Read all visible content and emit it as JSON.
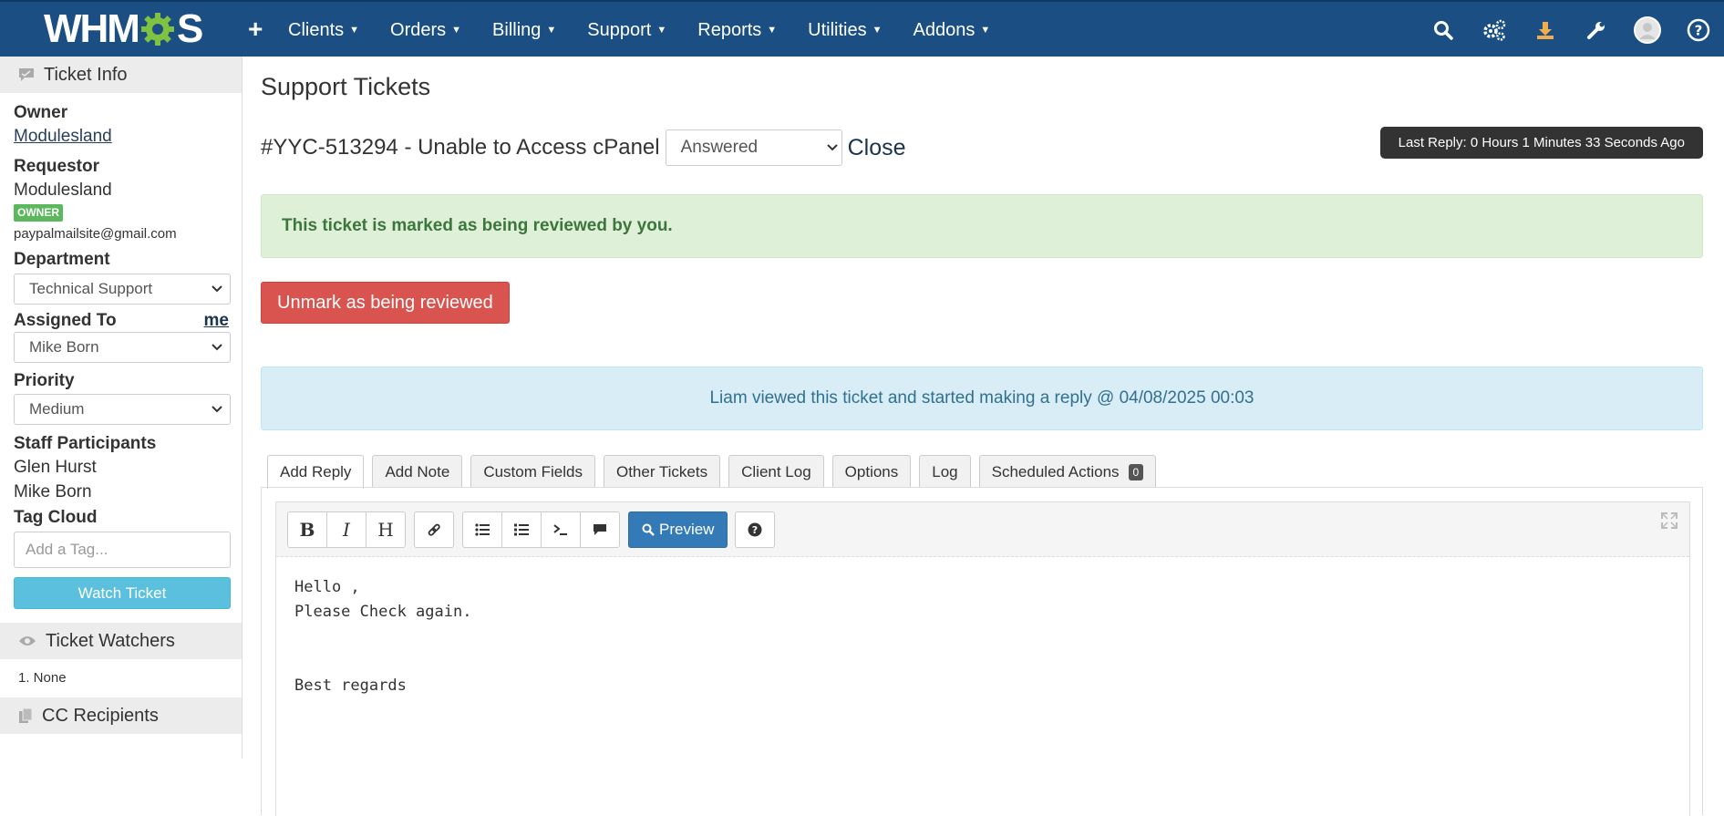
{
  "topbar": {
    "logo_left": "WHM",
    "logo_right": "S",
    "nav": [
      {
        "label": "Clients"
      },
      {
        "label": "Orders"
      },
      {
        "label": "Billing"
      },
      {
        "label": "Support"
      },
      {
        "label": "Reports"
      },
      {
        "label": "Utilities"
      },
      {
        "label": "Addons"
      }
    ],
    "icons": [
      "plus-icon",
      "search-icon",
      "cogs-icon",
      "download-icon",
      "wrench-icon",
      "avatar",
      "help-icon"
    ]
  },
  "sidebar": {
    "ticket_info_title": "Ticket Info",
    "owner_label": "Owner",
    "owner_value": "Modulesland",
    "requestor_label": "Requestor",
    "requestor_value": "Modulesland",
    "owner_badge": "OWNER",
    "email": "paypalmailsite@gmail.com",
    "department_label": "Department",
    "department_value": "Technical Support",
    "assigned_label": "Assigned To",
    "assigned_me": "me",
    "assigned_value": "Mike Born",
    "priority_label": "Priority",
    "priority_value": "Medium",
    "staff_label": "Staff Participants",
    "staff": [
      "Glen Hurst",
      "Mike Born"
    ],
    "tag_label": "Tag Cloud",
    "tag_placeholder": "Add a Tag...",
    "watch_button": "Watch Ticket",
    "watchers_title": "Ticket Watchers",
    "watchers_item": "1. None",
    "cc_title": "CC Recipients"
  },
  "main": {
    "page_title": "Support Tickets",
    "ticket_title": "#YYC-513294 - Unable to Access cPanel",
    "status_value": "Answered",
    "close_link": "Close",
    "last_reply": "Last Reply: 0 Hours 1 Minutes 33 Seconds Ago",
    "review_alert": "This ticket is marked as being reviewed by you.",
    "unmark_button": "Unmark as being reviewed",
    "info_alert": "Liam viewed this ticket and started making a reply @ 04/08/2025 00:03",
    "tabs": [
      {
        "label": "Add Reply"
      },
      {
        "label": "Add Note"
      },
      {
        "label": "Custom Fields"
      },
      {
        "label": "Other Tickets"
      },
      {
        "label": "Client Log"
      },
      {
        "label": "Options"
      },
      {
        "label": "Log"
      },
      {
        "label": "Scheduled Actions",
        "badge": "0"
      }
    ],
    "toolbar": {
      "bold": "B",
      "italic": "I",
      "heading": "H",
      "preview": "Preview"
    },
    "reply_text": "Hello ,\nPlease Check again.\n\n\nBest regards"
  },
  "colors": {
    "topbar": "#1b4f84",
    "success_bg": "#dff0d8",
    "danger": "#d9534f",
    "info_bg": "#d9edf7",
    "primary": "#337ab7",
    "watch": "#5bc0de"
  }
}
